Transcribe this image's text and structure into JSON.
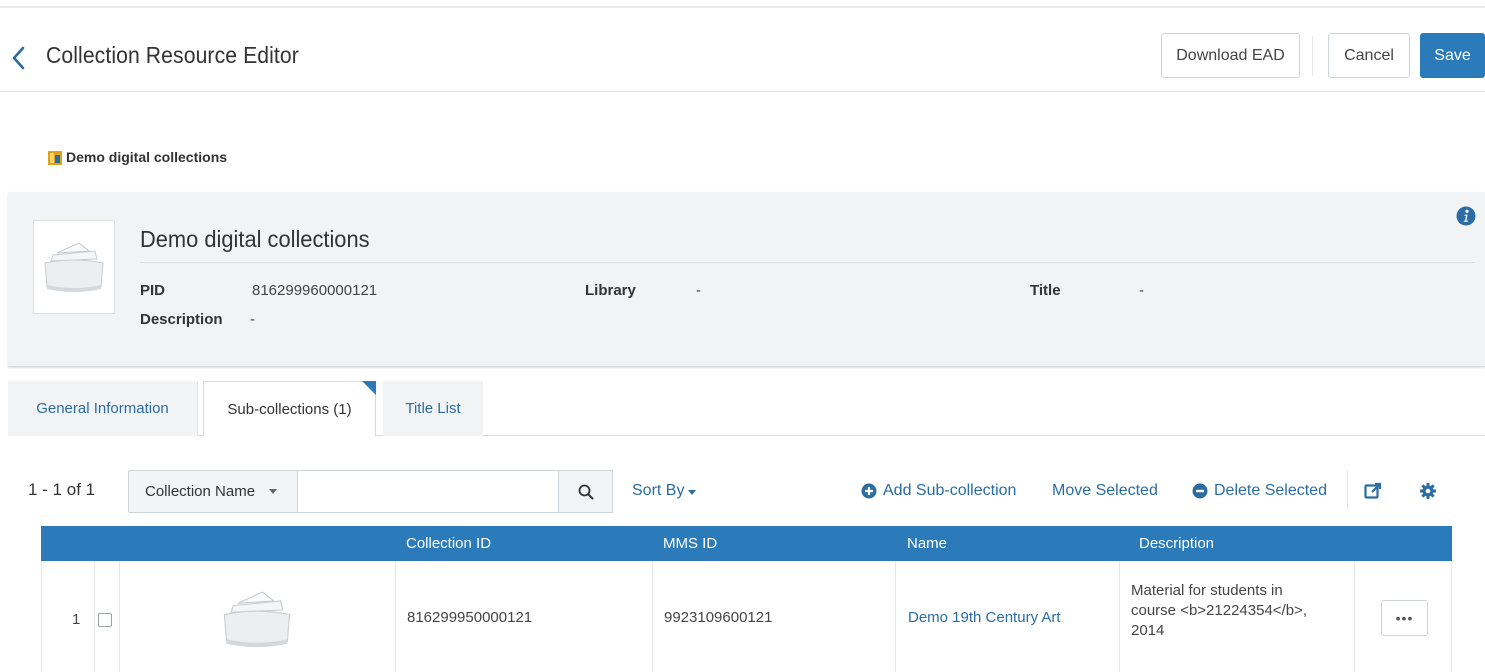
{
  "header": {
    "title": "Collection Resource Editor",
    "download_label": "Download EAD",
    "cancel_label": "Cancel",
    "save_label": "Save"
  },
  "breadcrumb": {
    "label": "Demo digital collections"
  },
  "summary": {
    "title": "Demo digital collections",
    "pid_label": "PID",
    "pid_value": "816299960000121",
    "library_label": "Library",
    "library_value": "-",
    "title_label": "Title",
    "title_value": "-",
    "description_label": "Description",
    "description_value": "-"
  },
  "tabs": [
    {
      "label": "General Information",
      "active": false
    },
    {
      "label": "Sub-collections (1)",
      "active": true
    },
    {
      "label": "Title List",
      "active": false
    }
  ],
  "toolbar": {
    "count": "1 - 1 of 1",
    "filter_field": "Collection Name",
    "search_value": "",
    "sort_label": "Sort By",
    "add_label": "Add Sub-collection",
    "move_label": "Move Selected",
    "delete_label": "Delete Selected"
  },
  "table": {
    "columns": [
      "Collection ID",
      "MMS ID",
      "Name",
      "Description"
    ],
    "rows": [
      {
        "num": "1",
        "collection_id": "816299950000121",
        "mms_id": "9923109600121",
        "name": "Demo 19th Century Art",
        "description": "Material for students in course <b>21224354</b>, 2014",
        "actions": "•••"
      }
    ]
  },
  "colors": {
    "primary": "#2b7bba",
    "link": "#2b6ca3",
    "panel_bg": "#f1f3f5"
  }
}
